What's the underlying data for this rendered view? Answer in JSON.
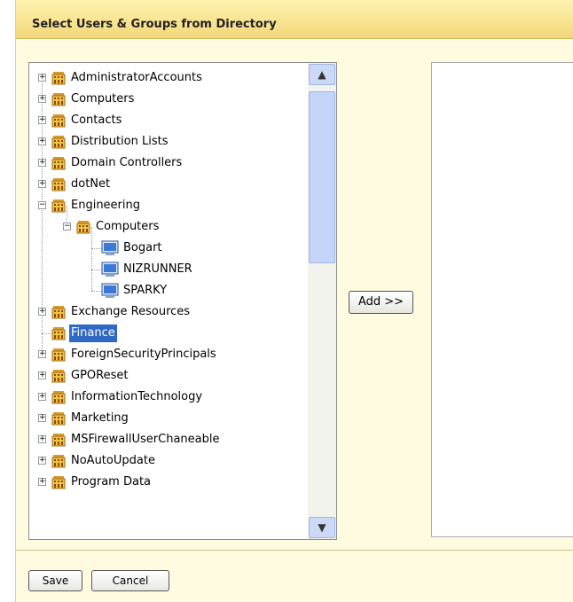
{
  "dialog": {
    "title": "Select Users & Groups from Directory"
  },
  "tree": {
    "items": [
      {
        "label": "AdministratorAccounts",
        "level": 0,
        "expander": "plus",
        "icon": "group-icon"
      },
      {
        "label": "Computers",
        "level": 0,
        "expander": "plus",
        "icon": "group-icon"
      },
      {
        "label": "Contacts",
        "level": 0,
        "expander": "plus",
        "icon": "group-icon"
      },
      {
        "label": "Distribution Lists",
        "level": 0,
        "expander": "plus",
        "icon": "group-icon"
      },
      {
        "label": "Domain Controllers",
        "level": 0,
        "expander": "plus",
        "icon": "group-icon"
      },
      {
        "label": "dotNet",
        "level": 0,
        "expander": "plus",
        "icon": "group-icon"
      },
      {
        "label": "Engineering",
        "level": 0,
        "expander": "minus",
        "icon": "group-icon"
      },
      {
        "label": "Computers",
        "level": 1,
        "expander": "minus",
        "icon": "group-icon"
      },
      {
        "label": "Bogart",
        "level": 2,
        "expander": "none",
        "icon": "computer-icon"
      },
      {
        "label": "NIZRUNNER",
        "level": 2,
        "expander": "none",
        "icon": "computer-icon"
      },
      {
        "label": "SPARKY",
        "level": 2,
        "expander": "none",
        "icon": "computer-icon"
      },
      {
        "label": "Exchange Resources",
        "level": 0,
        "expander": "plus",
        "icon": "group-icon"
      },
      {
        "label": "Finance",
        "level": 0,
        "expander": "none",
        "icon": "group-icon",
        "selected": true
      },
      {
        "label": "ForeignSecurityPrincipals",
        "level": 0,
        "expander": "plus",
        "icon": "group-icon"
      },
      {
        "label": "GPOReset",
        "level": 0,
        "expander": "plus",
        "icon": "group-icon"
      },
      {
        "label": "InformationTechnology",
        "level": 0,
        "expander": "plus",
        "icon": "group-icon"
      },
      {
        "label": "Marketing",
        "level": 0,
        "expander": "plus",
        "icon": "group-icon"
      },
      {
        "label": "MSFirewallUserChaneable",
        "level": 0,
        "expander": "plus",
        "icon": "group-icon"
      },
      {
        "label": "NoAutoUpdate",
        "level": 0,
        "expander": "plus",
        "icon": "group-icon"
      },
      {
        "label": "Program Data",
        "level": 0,
        "expander": "plus",
        "icon": "group-icon"
      }
    ],
    "scroll_up_icon": "chevron-up-icon",
    "scroll_down_icon": "chevron-down-icon"
  },
  "buttons": {
    "add": "Add >>",
    "save": "Save",
    "cancel": "Cancel"
  },
  "colors": {
    "title_bar": "#f2d77a",
    "panel_bg": "#fffbe0",
    "selection": "#316ac5"
  }
}
